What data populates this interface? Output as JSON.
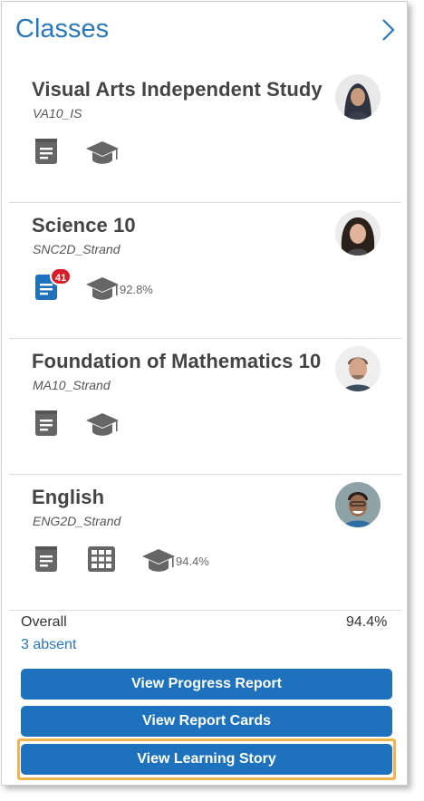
{
  "header": {
    "title": "Classes",
    "next_icon": "chevron-right-icon"
  },
  "classes": [
    {
      "name": "Visual Arts Independent Study",
      "code": "VA10_IS",
      "badge": "",
      "grade": "",
      "icons": [
        "assignments-icon",
        "graduation-cap-icon"
      ]
    },
    {
      "name": "Science 10",
      "code": "SNC2D_Strand",
      "badge": "41",
      "grade": "92.8%",
      "icons": [
        "assignments-icon",
        "graduation-cap-icon"
      ]
    },
    {
      "name": "Foundation of Mathematics 10",
      "code": "MA10_Strand",
      "badge": "",
      "grade": "",
      "icons": [
        "assignments-icon",
        "graduation-cap-icon"
      ]
    },
    {
      "name": "English",
      "code": "ENG2D_Strand",
      "badge": "",
      "grade": "94.4%",
      "icons": [
        "assignments-icon",
        "grid-icon",
        "graduation-cap-icon"
      ]
    }
  ],
  "summary": {
    "overall_label": "Overall",
    "overall_value": "94.4%",
    "absent_link": "3 absent"
  },
  "buttons": {
    "progress_report": "View Progress Report",
    "report_cards": "View Report Cards",
    "learning_story": "View Learning Story"
  },
  "colors": {
    "accent": "#1e72bd",
    "title_blue": "#2a78b8",
    "badge_red": "#d81e28",
    "highlight": "#f2b24c",
    "icon_gray": "#666666"
  }
}
